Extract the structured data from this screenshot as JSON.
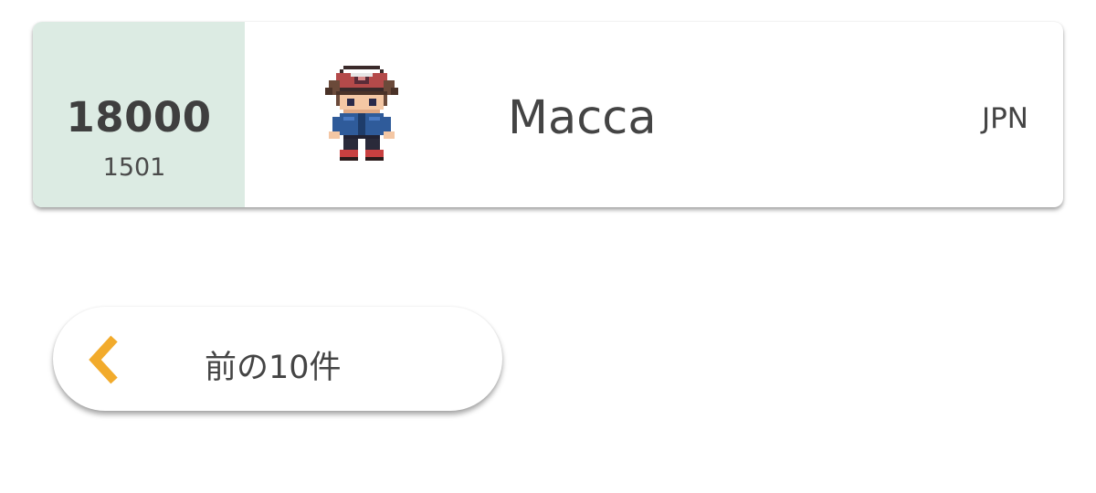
{
  "ranking_entry": {
    "rating": "18000",
    "rank": "1501",
    "avatar_icon": "trainer-sprite-icon",
    "player_name": "Macca",
    "country": "JPN"
  },
  "pagination": {
    "prev_label": "前の10件",
    "prev_icon": "chevron-left-icon",
    "accent_color": "#f2ab2c"
  },
  "colors": {
    "score_background": "#dcebe3",
    "text": "#444444"
  }
}
